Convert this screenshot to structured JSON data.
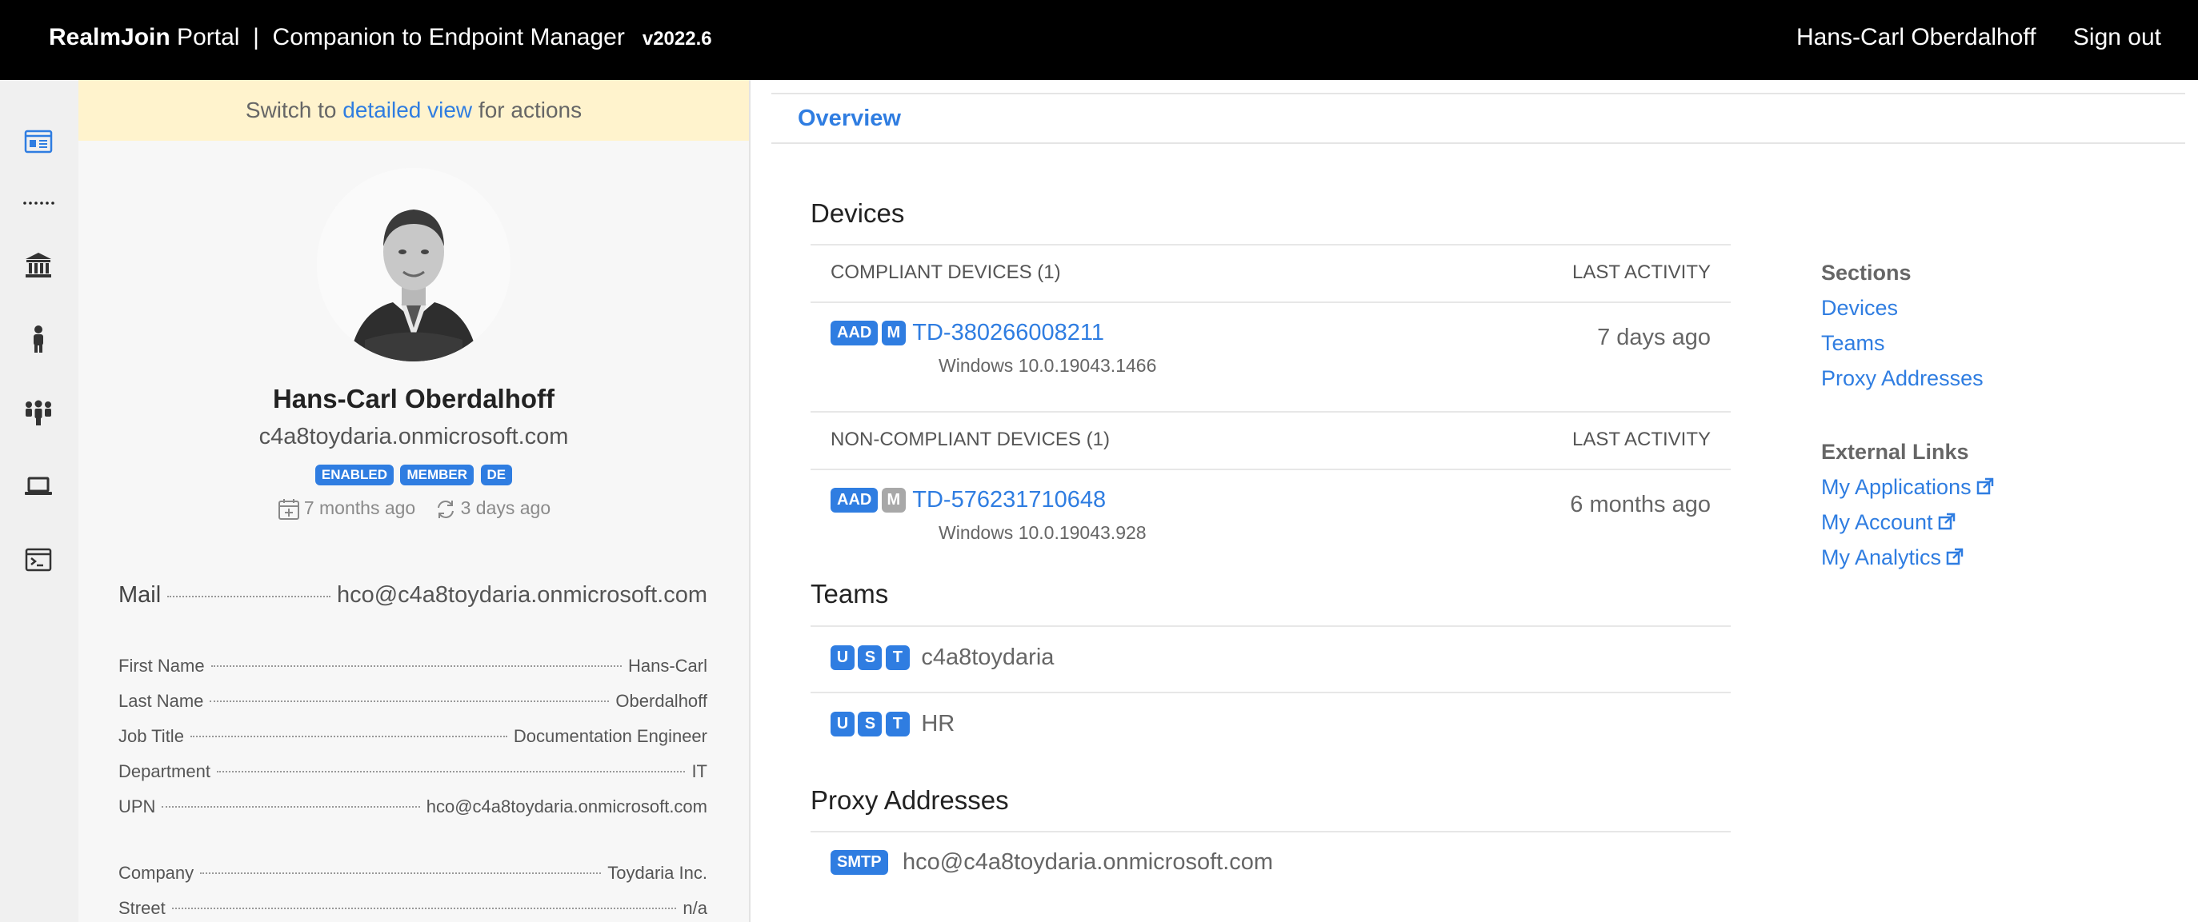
{
  "header": {
    "brand_bold": "RealmJoin",
    "brand_rest": " Portal  |  Companion to Endpoint Manager",
    "version": "v2022.6",
    "user": "Hans-Carl Oberdalhoff",
    "signout": "Sign out"
  },
  "rail": {
    "icons": [
      "overview-icon",
      "dotted-separator-icon",
      "institution-icon",
      "user-icon",
      "group-icon",
      "laptop-icon",
      "terminal-icon"
    ],
    "active_color": "#2f7de1"
  },
  "notice": {
    "prefix": "Switch to ",
    "link": "detailed view",
    "suffix": " for actions"
  },
  "profile": {
    "name": "Hans-Carl Oberdalhoff",
    "upn": "c4a8toydaria.onmicrosoft.com",
    "badges": [
      "ENABLED",
      "MEMBER",
      "DE"
    ],
    "created": "7 months ago",
    "synced": "3 days ago",
    "mail_label": "Mail",
    "mail_value": "hco@c4a8toydaria.onmicrosoft.com",
    "fields": [
      {
        "k": "First Name",
        "v": "Hans-Carl"
      },
      {
        "k": "Last Name",
        "v": "Oberdalhoff"
      },
      {
        "k": "Job Title",
        "v": "Documentation Engineer"
      },
      {
        "k": "Department",
        "v": "IT"
      },
      {
        "k": "UPN",
        "v": "hco@c4a8toydaria.onmicrosoft.com"
      }
    ],
    "fields2": [
      {
        "k": "Company",
        "v": "Toydaria Inc."
      },
      {
        "k": "Street",
        "v": "n/a"
      }
    ]
  },
  "main": {
    "tab": "Overview",
    "devices": {
      "heading": "Devices",
      "compliant_header": "COMPLIANT DEVICES (1)",
      "noncompliant_header": "NON-COMPLIANT DEVICES (1)",
      "last_activity": "LAST ACTIVITY",
      "compliant": [
        {
          "tags": [
            "AAD",
            "M"
          ],
          "name": "TD-380266008211",
          "os": "Windows 10.0.19043.1466",
          "last": "7 days ago"
        }
      ],
      "noncompliant": [
        {
          "tags": [
            "AAD",
            "M"
          ],
          "name": "TD-576231710648",
          "os": "Windows 10.0.19043.928",
          "last": "6 months ago"
        }
      ]
    },
    "teams": {
      "heading": "Teams",
      "items": [
        {
          "tags": [
            "U",
            "S",
            "T"
          ],
          "name": "c4a8toydaria"
        },
        {
          "tags": [
            "U",
            "S",
            "T"
          ],
          "name": "HR"
        }
      ]
    },
    "proxy": {
      "heading": "Proxy Addresses",
      "items": [
        {
          "tag": "SMTP",
          "value": "hco@c4a8toydaria.onmicrosoft.com"
        }
      ]
    }
  },
  "sections": {
    "title": "Sections",
    "links": [
      "Devices",
      "Teams",
      "Proxy Addresses"
    ],
    "external_title": "External Links",
    "external": [
      "My Applications",
      "My Account",
      "My Analytics"
    ]
  }
}
